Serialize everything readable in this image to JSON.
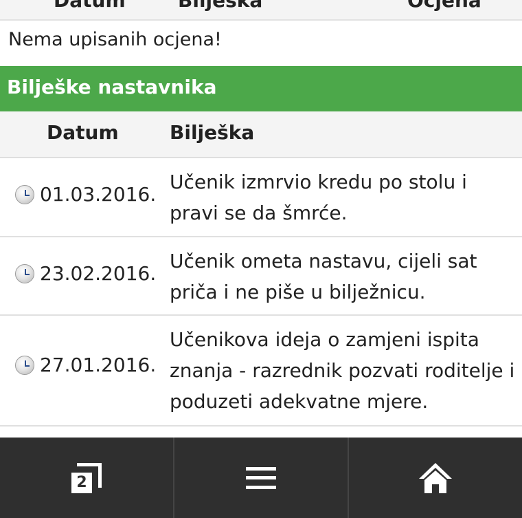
{
  "grades_table": {
    "headers": [
      "Datum",
      "Bilješka",
      "Ocjena"
    ],
    "empty_message": "Nema upisanih ocjena!"
  },
  "notes_section": {
    "title": "Bilješke nastavnika",
    "headers": {
      "date": "Datum",
      "note": "Bilješka"
    },
    "rows": [
      {
        "date": "01.03.2016.",
        "note": "Učenik izmrvio kredu po stolu i pravi se da šmrće."
      },
      {
        "date": "23.02.2016.",
        "note": "Učenik ometa nastavu, cijeli sat priča i ne piše u bilježnicu."
      },
      {
        "date": "27.01.2016.",
        "note": "Učenikova ideja o zamjeni ispita znanja - razrednik pozvati roditelje i poduzeti adekvatne mjere."
      }
    ]
  },
  "bottom_nav": {
    "windows_count": "2",
    "icons": [
      "windows-icon",
      "menu-icon",
      "home-icon"
    ]
  },
  "colors": {
    "section_bar": "#4ca84a",
    "nav_background": "#2f2f2f"
  }
}
